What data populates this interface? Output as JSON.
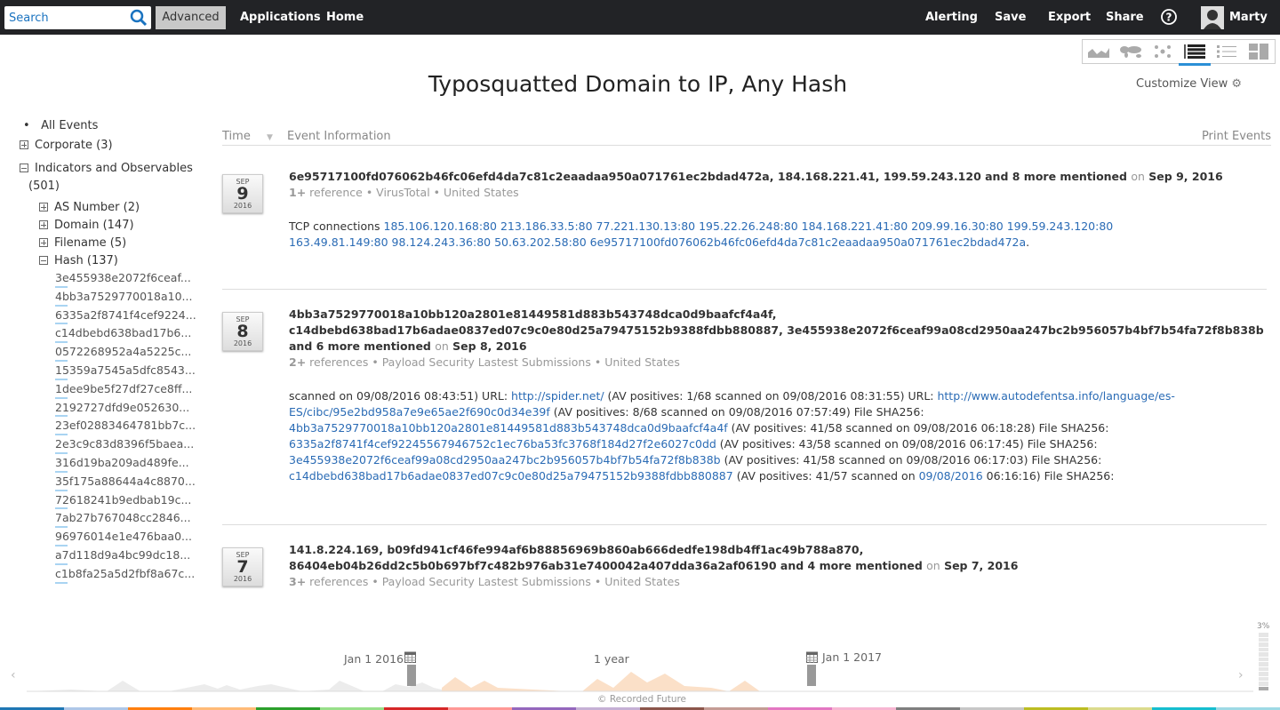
{
  "topbar": {
    "search_placeholder": "Search",
    "advanced": "Advanced",
    "applications": "Applications",
    "home": "Home",
    "alerting": "Alerting",
    "save": "Save",
    "export": "Export",
    "share": "Share",
    "user": "Marty"
  },
  "view_modes": [
    "timeline-icon",
    "map-icon",
    "network-icon",
    "table-list-icon",
    "list-icon",
    "grid-icon"
  ],
  "active_view": "table-list-icon",
  "title": "Typosquatted Domain to IP, Any Hash",
  "customize": "Customize View",
  "sidebar": {
    "all": "All Events",
    "corporate": "Corporate (3)",
    "indicators": "Indicators and Observables",
    "indicators_count": "(501)",
    "children": [
      {
        "label": "AS Number (2)",
        "expanded": false
      },
      {
        "label": "Domain (147)",
        "expanded": false
      },
      {
        "label": "Filename (5)",
        "expanded": false
      },
      {
        "label": "Hash (137)",
        "expanded": true
      }
    ],
    "hashes": [
      "3e455938e2072f6ceaf...",
      "4bb3a7529770018a10...",
      "6335a2f8741f4cef9224...",
      "c14dbebd638bad17b6...",
      "0572268952a4a5225c...",
      "15359a7545a5dfc8543...",
      "1dee9be5f27df27ce8ff...",
      "2192727dfd9e052630...",
      "23ef02883464781bb7c...",
      "2e3c9c83d8396f5baea...",
      "316d19ba209ad489fe...",
      "35f175a88644a4c8870...",
      "72618241b9edbab19c...",
      "7ab27b767048cc2846...",
      "96976014e1e476baa0...",
      "a7d118d9a4bc99dc18...",
      "c1b8fa25a5d2fbf8a67c..."
    ]
  },
  "table": {
    "time": "Time",
    "info": "Event Information",
    "print": "Print Events"
  },
  "events": [
    {
      "month": "SEP",
      "day": "9",
      "year": "2016",
      "headline": "6e95717100fd076062b46fc06efd4da7c81c2eaadaa950a071761ec2bdad472a, 184.168.221.41, 199.59.243.120 and 8 more mentioned",
      "on": "on",
      "date": "Sep 9, 2016",
      "refs": "1+",
      "refs_label": "reference",
      "source": "VirusTotal",
      "country": "United States",
      "desc": [
        {
          "t": "TCP connections "
        },
        {
          "t": "185.106.120.168:80 213.186.33.5:80 77.221.130.13:80 195.22.26.248:80 184.168.221.41:80 209.99.16.30:80 199.59.243.120:80 163.49.81.149:80 98.124.243.36:80 50.63.202.58:80 6e95717100fd076062b46fc06efd4da7c81c2eaadaa950a071761ec2bdad472a",
          "l": true
        },
        {
          "t": "."
        }
      ]
    },
    {
      "month": "SEP",
      "day": "8",
      "year": "2016",
      "headline": "4bb3a7529770018a10bb120a2801e81449581d883b543748dca0d9baafcf4a4f, c14dbebd638bad17b6adae0837ed07c9c0e80d25a79475152b9388fdbb880887, 3e455938e2072f6ceaf99a08cd2950aa247bc2b956057b4bf7b54fa72f8b838b and 6 more mentioned",
      "on": "on",
      "date": "Sep 8, 2016",
      "refs": "2+",
      "refs_label": "references",
      "source": "Payload Security Lastest Submissions",
      "country": "United States",
      "desc": [
        {
          "t": "scanned on 09/08/2016 08:43:51) URL: "
        },
        {
          "t": "http://spider.net/",
          "l": true
        },
        {
          "t": " (AV positives: 1/68 scanned on 09/08/2016 08:31:55) URL: "
        },
        {
          "t": "http://www.autodefentsa.info/language/es-ES/cibc/95e2bd958a7e9e65ae2f690c0d34e39f",
          "l": true
        },
        {
          "t": " (AV positives: 8/68 scanned on 09/08/2016 07:57:49) File SHA256: "
        },
        {
          "t": "4bb3a7529770018a10bb120a2801e81449581d883b543748dca0d9baafcf4a4f",
          "l": true
        },
        {
          "t": " (AV positives: 41/58 scanned on 09/08/2016 06:18:28) File SHA256: "
        },
        {
          "t": "6335a2f8741f4cef92245567946752c1ec76ba53fc3768f184d27f2e6027c0dd",
          "l": true
        },
        {
          "t": " (AV positives: 43/58 scanned on 09/08/2016 06:17:45) File SHA256: "
        },
        {
          "t": "3e455938e2072f6ceaf99a08cd2950aa247bc2b956057b4bf7b54fa72f8b838b",
          "l": true
        },
        {
          "t": " (AV positives: 41/58 scanned on 09/08/2016 06:17:03) File SHA256: "
        },
        {
          "t": "c14dbebd638bad17b6adae0837ed07c9c0e80d25a79475152b9388fdbb880887",
          "l": true
        },
        {
          "t": " (AV positives: 41/57 scanned on "
        },
        {
          "t": "09/08/2016",
          "l": true
        },
        {
          "t": " 06:16:16) File SHA256:"
        }
      ]
    },
    {
      "month": "SEP",
      "day": "7",
      "year": "2016",
      "headline": "141.8.224.169, b09fd941cf46fe994af6b88856969b860ab666dedfe198db4ff1ac49b788a870, 86404eb04b26dd2c5b0b697bf7c482b976ab31e7400042a407dda36a2af06190 and 4 more mentioned",
      "on": "on",
      "date": "Sep 7, 2016",
      "refs": "3+",
      "refs_label": "references",
      "source": "Payload Security Lastest Submissions",
      "country": "United States",
      "desc": []
    }
  ],
  "timeline": {
    "start": "Jan 1 2016",
    "span": "1 year",
    "end": "Jan 1 2017",
    "percent": "3%",
    "footer": "© Recorded Future"
  },
  "colors": {
    "topbar": "#222326",
    "link": "#2a6bb5",
    "accent": "#2b8fd6",
    "selection": "#fbe0c8",
    "palette": [
      "#1f77b4",
      "#aec7e8",
      "#ff7f0e",
      "#ffbb78",
      "#2ca02c",
      "#98df8a",
      "#d62728",
      "#ff9896",
      "#9467bd",
      "#c5b0d5",
      "#8c564b",
      "#c49c94",
      "#e377c2",
      "#f7b6d2",
      "#7f7f7f",
      "#c7c7c7",
      "#bcbd22",
      "#dbdb8d",
      "#17becf",
      "#9edae5"
    ]
  }
}
